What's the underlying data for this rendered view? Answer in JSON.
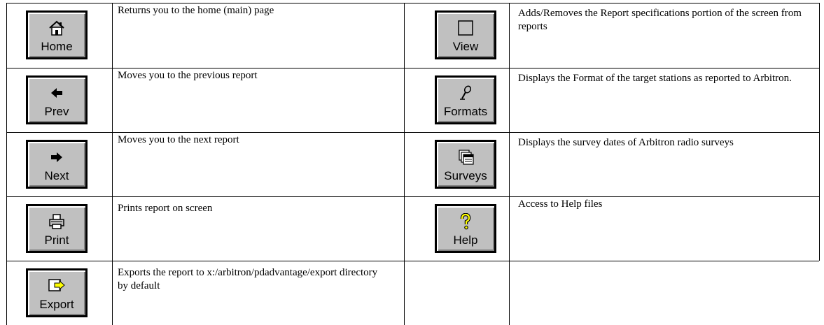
{
  "left_rows": [
    {
      "button": "Home",
      "icon": "home-icon",
      "description": "Returns you to the home (main) page"
    },
    {
      "button": "Prev",
      "icon": "left-arrow-icon",
      "description": "Moves you to the previous report"
    },
    {
      "button": "Next",
      "icon": "right-arrow-icon",
      "description": "Moves you to the next report"
    },
    {
      "button": "Print",
      "icon": "printer-icon",
      "description": "Prints report on screen"
    },
    {
      "button": "Export",
      "icon": "export-arrow-icon",
      "description": "Exports the report to x:/arbitron/pdadvantage/export directory by default"
    }
  ],
  "right_rows": [
    {
      "button": "View",
      "icon": "view-window-icon",
      "description": "Adds/Removes the Report specifications portion of the screen from reports"
    },
    {
      "button": "Formats",
      "icon": "microphone-icon",
      "description": "Displays the Format of the target stations as reported to Arbitron."
    },
    {
      "button": "Surveys",
      "icon": "calendar-stack-icon",
      "description": "Displays the survey dates of Arbitron radio surveys"
    },
    {
      "button": "Help",
      "icon": "question-mark-icon",
      "description": "Access to Help files"
    }
  ],
  "colors": {
    "button_face": "#c0c0c0",
    "help_icon": "#ffff00",
    "export_arrow": "#ffff00"
  }
}
